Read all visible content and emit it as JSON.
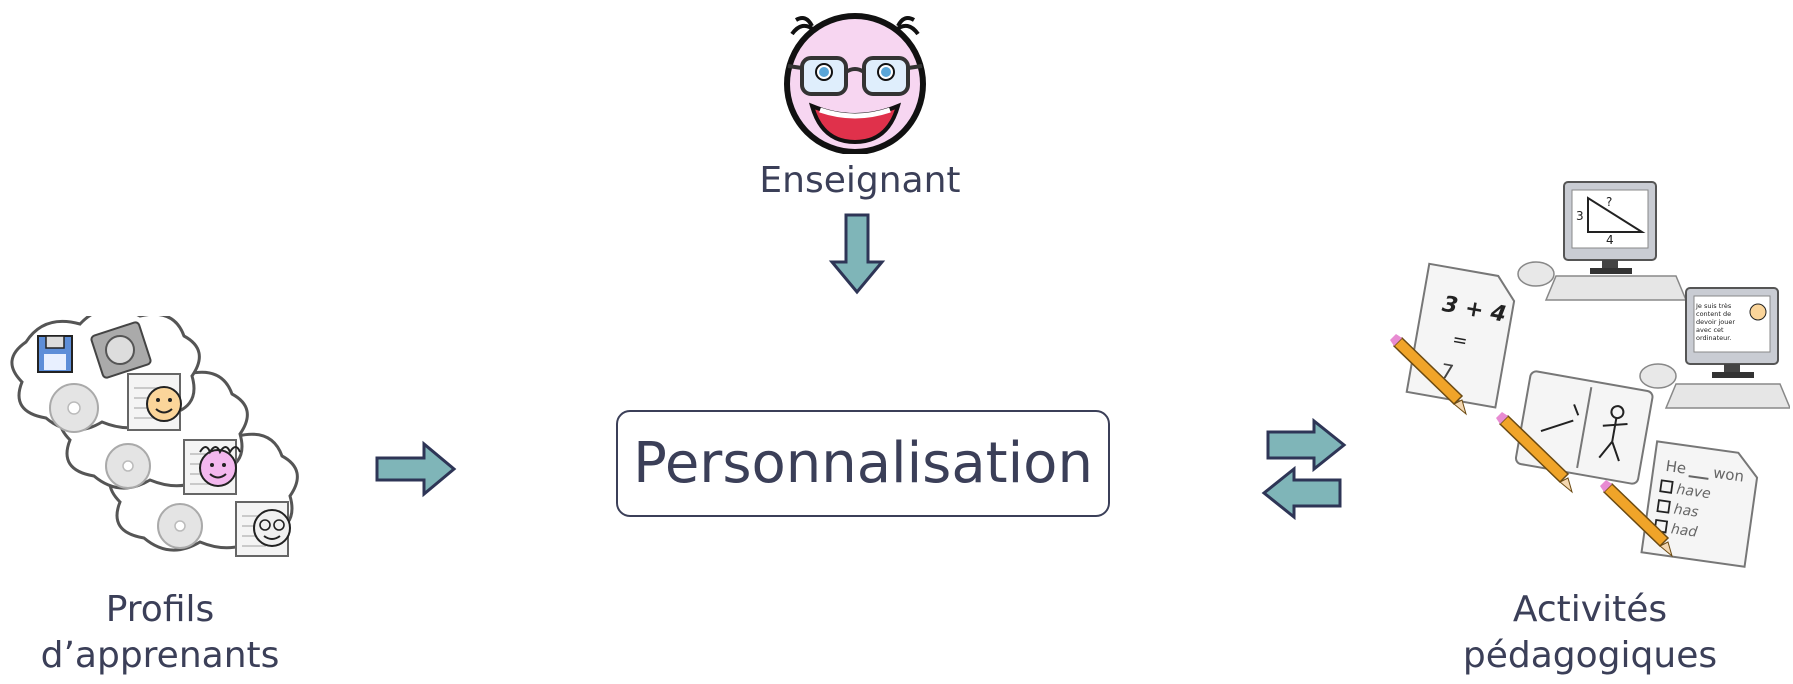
{
  "teacher": {
    "label": "Enseignant",
    "icon": "teacher-face-icon"
  },
  "center": {
    "label": "Personnalisation"
  },
  "profiles": {
    "line1": "Profils",
    "line2": "d’apprenants",
    "icon": "learner-profiles-icon"
  },
  "activities": {
    "line1": "Activités",
    "line2": "pédagogiques",
    "icon": "learning-activities-icon",
    "math_sheet": {
      "expr": "3 + 4",
      "eq": "=",
      "answer": "7"
    },
    "monitor1": {
      "q": "?",
      "side_a": "3",
      "side_b": "4"
    },
    "monitor2_text": [
      "Je suis très",
      "content de",
      "devoir jouer",
      "avec cet",
      "ordinateur."
    ],
    "quiz": {
      "prompt_a": "He",
      "prompt_b": "won",
      "options": [
        "have",
        "has",
        "had"
      ]
    }
  },
  "colors": {
    "arrow_fill": "#7fb5b8",
    "arrow_stroke": "#2e3556",
    "text": "#3b3f58",
    "face_pink": "#f7d6f1"
  }
}
